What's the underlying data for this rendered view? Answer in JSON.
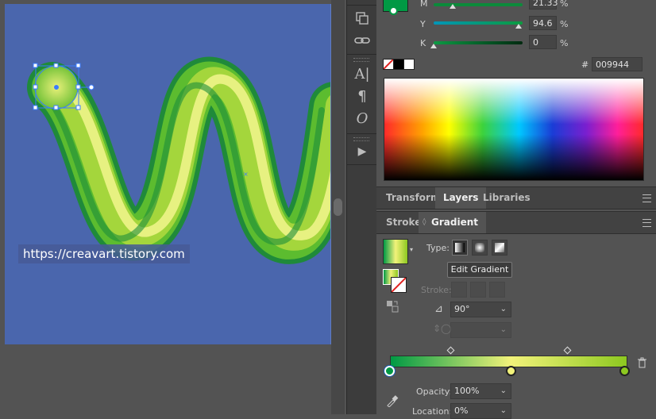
{
  "canvas": {
    "watermark": "https://creavart.tistory.com"
  },
  "color_panel": {
    "values": [
      {
        "label": "M",
        "value": "21.33",
        "unit": "%"
      },
      {
        "label": "Y",
        "value": "94.6",
        "unit": "%"
      },
      {
        "label": "K",
        "value": "0",
        "unit": "%"
      }
    ],
    "hex_label": "#",
    "hex_value": "009944"
  },
  "tabs_top": [
    {
      "label": "Transform"
    },
    {
      "label": "Layers"
    },
    {
      "label": "Libraries"
    }
  ],
  "tabs_gradient": [
    {
      "label": "Stroke"
    },
    {
      "label": "Gradient"
    }
  ],
  "gradient": {
    "type_label": "Type:",
    "edit_button": "Edit Gradient",
    "stroke_label": "Stroke:",
    "angle_value": "90°",
    "opacity_label": "Opacity:",
    "opacity_value": "100%",
    "location_label": "Location:",
    "location_value": "0%",
    "stops": [
      {
        "color": "#009944",
        "location": 0
      },
      {
        "color": "#f2f27a",
        "location": 51
      },
      {
        "color": "#8dc820",
        "location": 100
      }
    ]
  },
  "colors": {
    "artboard": "#4a66ad",
    "panel_bg": "#535353",
    "accent": "#009944"
  },
  "icons": {
    "eyedropper": "eyedropper-icon",
    "trash": "trash-icon"
  }
}
